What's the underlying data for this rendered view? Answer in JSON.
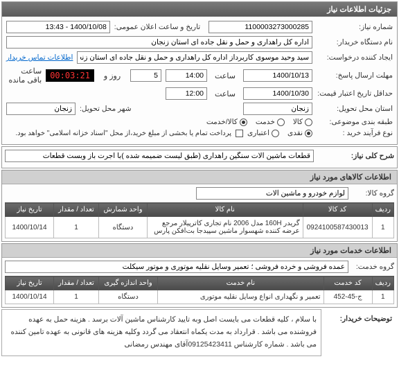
{
  "header": {
    "title": "جزئیات اطلاعات نیاز"
  },
  "form": {
    "need_no_label": "شماره نیاز:",
    "need_no": "1100003273000285",
    "announce_label": "تاریخ و ساعت اعلان عمومی:",
    "announce_value": "1400/10/08 - 13:43",
    "buyer_label": "نام دستگاه خریدار:",
    "buyer_value": "اداره کل راهداری و حمل و نقل جاده ای استان زنجان",
    "creator_label": "ایجاد کننده درخواست:",
    "creator_value": "سید وحید موسوی کاربرداز اداره کل راهداری و حمل و نقل جاده ای استان زنجان",
    "contact_link": "اطلاعات تماس خریدار",
    "deadline_label": "مهلت ارسال پاسخ:",
    "deadline_date": "1400/10/13",
    "time_label": "ساعت",
    "deadline_time": "14:00",
    "day_label": "روز و",
    "day_value": "5",
    "remain_label": "ساعت باقی مانده",
    "timer": "00:03:21",
    "validity_label": "حداقل تاریخ اعتبار قیمت:",
    "validity_date": "1400/10/30",
    "validity_time": "12:00",
    "province_label": "استان محل تحویل:",
    "province_value": "زنجان",
    "city_label": "شهر محل تحویل:",
    "city_value": "زنجان",
    "category_label": "طبقه بندی موضوعی:",
    "cat_goods": "کالا",
    "cat_service": "خدمت",
    "cat_both": "کالا/خدمت",
    "buy_type_label": "نوع فرآیند خرید :",
    "bt_cash": "نقدی",
    "bt_credit": "اعتباری",
    "credit_note": "پرداخت تمام یا بخشی از مبلغ خرید،از محل \"اسناد خزانه اسلامی\" خواهد بود."
  },
  "need": {
    "section_label": "شرح کلی نیاز:",
    "text": "قطعات ماشین آلات سنگین راهداری (طبق لیست ضمیمه شده )با اجرت باز وبست قطعات"
  },
  "goods": {
    "section_title": "اطلاعات کالاهای مورد نیاز",
    "group_label": "گروه کالا:",
    "group_value": "لوازم خودرو و ماشین آلات",
    "headers": {
      "row": "ردیف",
      "code": "کد کالا",
      "name": "نام کالا",
      "unit": "واحد شمارش",
      "qty": "تعداد / مقدار",
      "date": "تاریخ نیاز"
    },
    "rows": [
      {
        "row": "1",
        "code": "0924100587430013",
        "name": "گریدر 160H مدل 2006 نام تجاری کاترپیلار مرجع عرضه کننده شهسوار ماشین سپیدجا بت‌افکن پارس",
        "unit": "دستگاه",
        "qty": "1",
        "date": "1400/10/14"
      }
    ]
  },
  "services": {
    "section_title": "اطلاعات خدمات مورد نیاز",
    "group_label": "گروه خدمت:",
    "group_value": "عمده فروشی و خرده فروشی ؛ تعمیر وسایل نقلیه موتوری و موتور سیکلت",
    "headers": {
      "row": "ردیف",
      "code": "کد خدمت",
      "name": "نام خدمت",
      "unit": "واحد اندازه گیری",
      "qty": "تعداد / مقدار",
      "date": "تاریخ نیاز"
    },
    "rows": [
      {
        "row": "1",
        "code": "ج-45-452",
        "name": "تعمیر و نگهداری انواع وسایل نقلیه موتوری",
        "unit": "دستگاه",
        "qty": "1",
        "date": "1400/10/14"
      }
    ]
  },
  "notes": {
    "label": "توضیحات خریدار:",
    "text": "با سلام ، کلیه قطعات می بایست اصل وبه تایید کارشناس ماشین آلات برسد . هزینه حمل به عهده فروشنده می باشد . قرارداد به مدت یکماه انتعقاد می گردد وکلیه هزینه های قانونی به عهده تامین کننده می باشد . شماره کارشناس 09125423411آقای مهندس رمضانی"
  }
}
